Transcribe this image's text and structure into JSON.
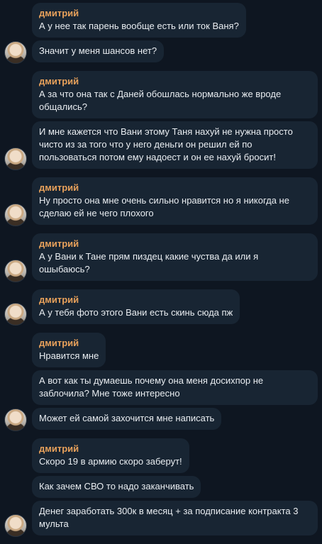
{
  "chat": {
    "groups": [
      {
        "messages": [
          {
            "sender": "дмитрий",
            "text": "А у нее так парень вообще есть или ток Ваня?"
          },
          {
            "sender": "",
            "text": "Значит у меня шансов нет?"
          }
        ]
      },
      {
        "messages": [
          {
            "sender": "дмитрий",
            "text": "А за что она так с Даней обошлась нормально же вроде общались?"
          },
          {
            "sender": "",
            "text": "И мне кажется что Вани этому Таня нахуй не нужна просто чисто из за того что у него деньги он решил ей по пользоваться потом ему надоест и он ее нахуй бросит!"
          }
        ]
      },
      {
        "messages": [
          {
            "sender": "дмитрий",
            "text": "Ну просто она мне очень сильно нравится но я никогда не сделаю ей не чего плохого"
          }
        ]
      },
      {
        "messages": [
          {
            "sender": "дмитрий",
            "text": "А у Вани к Тане прям пиздец какие чуства да или я ошыбаюсь?"
          }
        ]
      },
      {
        "messages": [
          {
            "sender": "дмитрий",
            "text": "А у тебя фото этого Вани есть скинь сюда пж"
          }
        ]
      },
      {
        "messages": [
          {
            "sender": "дмитрий",
            "text": "Нравится мне"
          },
          {
            "sender": "",
            "text": "А вот как ты думаешь почему она меня досихпор не заблочила? Мне тоже интересно"
          },
          {
            "sender": "",
            "text": "Может ей самой захочится мне написать"
          }
        ]
      },
      {
        "messages": [
          {
            "sender": "дмитрий",
            "text": "Скоро 19 в армию скоро заберут!"
          },
          {
            "sender": "",
            "text": "Как зачем СВО то надо заканчивать"
          },
          {
            "sender": "",
            "text": "Денег заработать 300к в месяц + за подписание контракта 3 мульта"
          }
        ]
      }
    ]
  }
}
